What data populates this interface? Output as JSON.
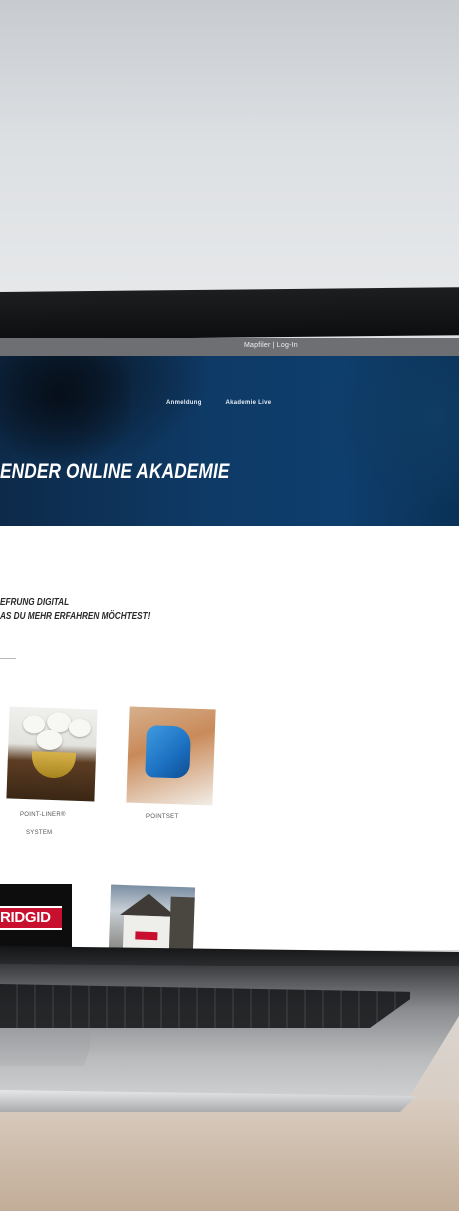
{
  "screen": {
    "util_links": "Mapfiler  |  Log-In",
    "nav": [
      "Anmeldung",
      "Akademie Live"
    ],
    "hero_title": "ENDER ONLINE AKADEMIE",
    "section_title_line1": "EFRUNG DIGITAL",
    "section_title_line2": "AS DU MEHR ERFAHREN MÖCHTEST!",
    "cards": [
      {
        "label_line1": "POINT-LINER®",
        "label_line2": "SYSTEM"
      },
      {
        "label_line1": "POINTSET"
      }
    ],
    "brand_logo": "RIDGID"
  },
  "colors": {
    "hero_blue": "#0e3a66",
    "util_bar": "#6d6f72",
    "ridgid_red": "#c8102e"
  }
}
